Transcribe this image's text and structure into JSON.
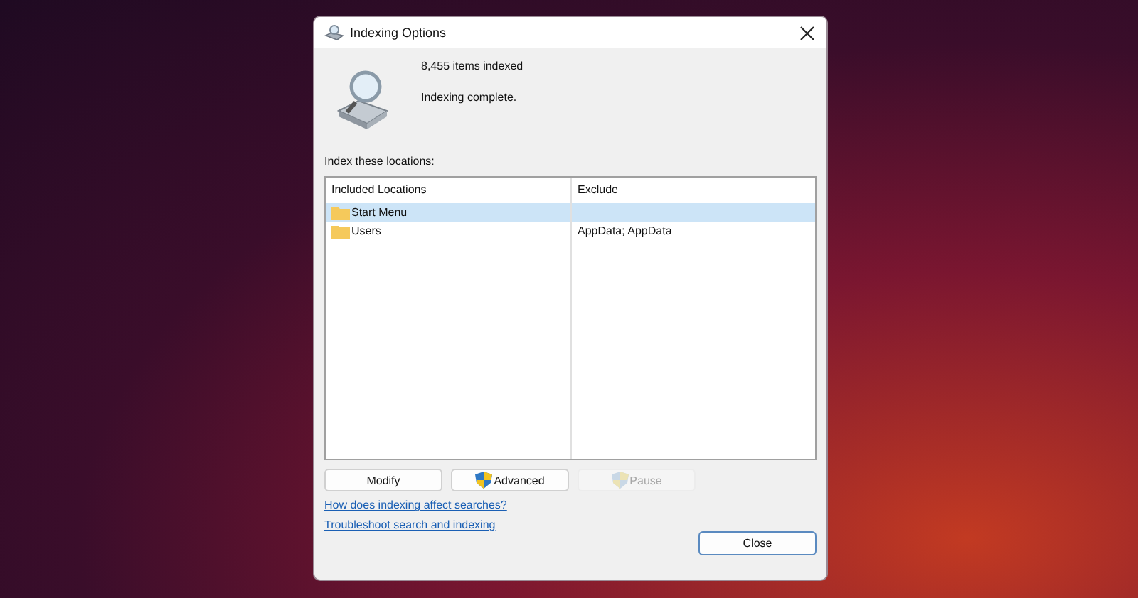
{
  "window": {
    "title": "Indexing Options"
  },
  "status": {
    "count": "8,455 items indexed",
    "message": "Indexing complete."
  },
  "locations_label": "Index these locations:",
  "table": {
    "columns": [
      "Included Locations",
      "Exclude"
    ],
    "rows": [
      {
        "location": "Start Menu",
        "exclude": "",
        "selected": true
      },
      {
        "location": "Users",
        "exclude": "AppData; AppData",
        "selected": false
      }
    ]
  },
  "buttons": [
    {
      "label": "Modify",
      "kind": "plain",
      "disabled": false
    },
    {
      "label": "Advanced",
      "kind": "shield",
      "disabled": false
    },
    {
      "label": "Pause",
      "kind": "shield",
      "disabled": true
    }
  ],
  "links": [
    "How does indexing affect searches?",
    "Troubleshoot search and indexing"
  ],
  "close_button": "Close"
}
